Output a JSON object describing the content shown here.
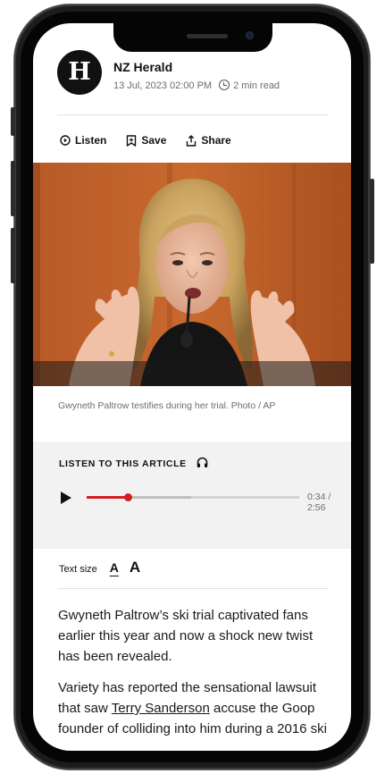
{
  "publisher": {
    "logo_letter": "H",
    "name": "NZ Herald",
    "date": "13 Jul, 2023 02:00 PM",
    "read_time": "2 min read"
  },
  "actions": {
    "listen": "Listen",
    "save": "Save",
    "share": "Share"
  },
  "photo": {
    "caption": "Gwyneth Paltrow testifies during her trial. Photo / AP"
  },
  "audio_player": {
    "title": "LISTEN TO THIS ARTICLE",
    "time": "0:34 / 2:56",
    "progress_fraction": 0.193,
    "buffered_fraction": 0.49,
    "accent_color": "#d31f22"
  },
  "text_size": {
    "label": "Text size",
    "small": "A",
    "large": "A"
  },
  "article": {
    "p1": "Gwyneth Paltrow’s ski trial captivated fans earlier this year and now a shock new twist has been revealed.",
    "p2_before": "Variety has reported the sensational lawsuit that saw ",
    "p2_link": "Terry Sanderson",
    "p2_after": " accuse the Goop founder of colliding into him during a 2016 ski"
  },
  "icons": [
    "play-circle-icon",
    "bookmark-icon",
    "share-icon",
    "clock-icon",
    "headphones-icon",
    "play-icon"
  ]
}
